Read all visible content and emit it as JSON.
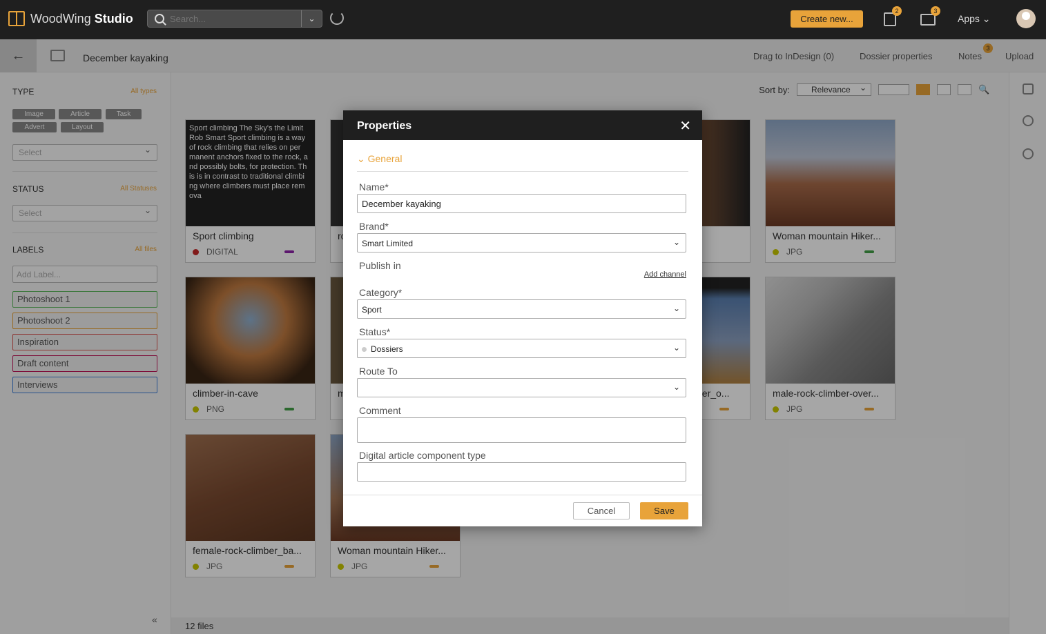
{
  "topbar": {
    "brand_plain": "WoodWing",
    "brand_bold": "Studio",
    "search_placeholder": "Search...",
    "create_label": "Create new...",
    "badge_tasks": "2",
    "badge_inbox": "3",
    "apps_label": "Apps ⌄"
  },
  "subbar": {
    "title": "December kayaking",
    "actions": [
      "Drag to InDesign (0)",
      "Dossier properties",
      "Notes",
      "Upload"
    ],
    "notes_badge": "3"
  },
  "leftpanel": {
    "type_heading": "TYPE",
    "type_link": "All types",
    "type_chips": [
      "Image",
      "Article",
      "Task",
      "Advert",
      "Layout"
    ],
    "type_select": "Select",
    "status_heading": "STATUS",
    "status_link": "All Statuses",
    "status_select": "Select",
    "labels_heading": "LABELS",
    "labels_link": "All files",
    "labels_placeholder": "Add Label...",
    "labels": [
      {
        "text": "Photoshoot 1",
        "color": "#5cb85c"
      },
      {
        "text": "Photoshoot 2",
        "color": "#e8a33a"
      },
      {
        "text": "Inspiration",
        "color": "#d9534f"
      },
      {
        "text": "Draft content",
        "color": "#c2185b"
      },
      {
        "text": "Interviews",
        "color": "#3b7dd8"
      }
    ],
    "collapse_icon": "«"
  },
  "main": {
    "sort_label": "Sort by:",
    "sort_value": "Relevance",
    "footer": "12 files",
    "cards": [
      {
        "name": "Sport climbing",
        "format": "DIGITAL",
        "dot": "#c62828",
        "bar": "#8e24aa",
        "article": "Sport climbing The Sky's the Limit Rob Smart Sport climbing is a way of rock climbing that relies on per manent anchors fixed to the rock, a nd possibly bolts, for protection. Th is is in contrast to traditional climbi ng where climbers must place rem ova"
      },
      {
        "name": "Woman mountain Hiker...",
        "format": "JPG",
        "dot": "#c8c800",
        "bar": "#43a047"
      },
      {
        "name": "climber-in-cave",
        "format": "PNG",
        "dot": "#c8c800",
        "bar": "#43a047"
      },
      {
        "name": "male-rock-climber-over...",
        "format": "JPG",
        "dot": "#c8c800",
        "bar": "#e8a33a"
      },
      {
        "name": "female-rock-climber_ba...",
        "format": "JPG",
        "dot": "#c8c800",
        "bar": "#e8a33a"
      },
      {
        "name": "Woman mountain Hiker...",
        "format": "JPG",
        "dot": "#c8c800",
        "bar": "#e8a33a"
      }
    ],
    "partial_names": [
      "ro",
      "m",
      "ber_o..."
    ]
  },
  "modal": {
    "title": "Properties",
    "close_icon": "✕",
    "section": "General",
    "section_chevron": "⌄",
    "name_label": "Name*",
    "name_value": "December kayaking",
    "brand_label": "Brand*",
    "brand_value": "Smart Limited",
    "publish_label": "Publish in",
    "add_channel": "Add channel",
    "category_label": "Category*",
    "category_value": "Sport",
    "status_label": "Status*",
    "status_value": "Dossiers",
    "route_label": "Route To",
    "route_value": "",
    "comment_label": "Comment",
    "comment_value": "",
    "digital_label": "Digital article component type",
    "digital_value": "",
    "cancel": "Cancel",
    "save": "Save"
  }
}
